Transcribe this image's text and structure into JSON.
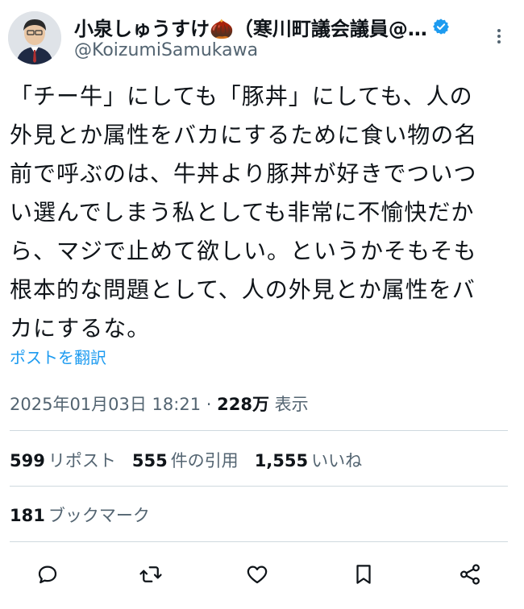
{
  "author": {
    "display_name": "小泉しゅうすけ🌰（寒川町議会議員@…",
    "handle": "@KoizumiSamukawa",
    "verified": true
  },
  "post": {
    "text": "「チー牛」にしても「豚丼」にしても、人の\n外見とか属性をバカにするために食い物の名\n前で呼ぶのは、牛丼より豚丼が好きでついつ\nい選んでしまう私としても非常に不愉快だか\nら、マジで止めて欲しい。というかそもそも\n根本的な問題として、人の外見とか属性をバ\nカにするな。",
    "translate_link": "ポストを翻訳",
    "timestamp": "2025年01月03日 18:21",
    "separator": " · ",
    "views_count": "228万",
    "views_label": " 表示"
  },
  "stats": {
    "reposts": {
      "count": "599",
      "label": "リポスト"
    },
    "quotes": {
      "count": "555",
      "label": "件の引用"
    },
    "likes": {
      "count": "1,555",
      "label": "いいね"
    },
    "bookmarks": {
      "count": "181",
      "label": "ブックマーク"
    }
  },
  "colors": {
    "text": "#0f1419",
    "secondary": "#536471",
    "link": "#1d9bf0",
    "divider": "#cfd9de",
    "verified_badge": "#1d9bf0"
  },
  "icons": {
    "reply": "speech-bubble-icon",
    "repost": "repost-arrows-icon",
    "like": "heart-icon",
    "bookmark": "bookmark-icon",
    "share": "share-icon",
    "more": "more-vertical-icon"
  }
}
